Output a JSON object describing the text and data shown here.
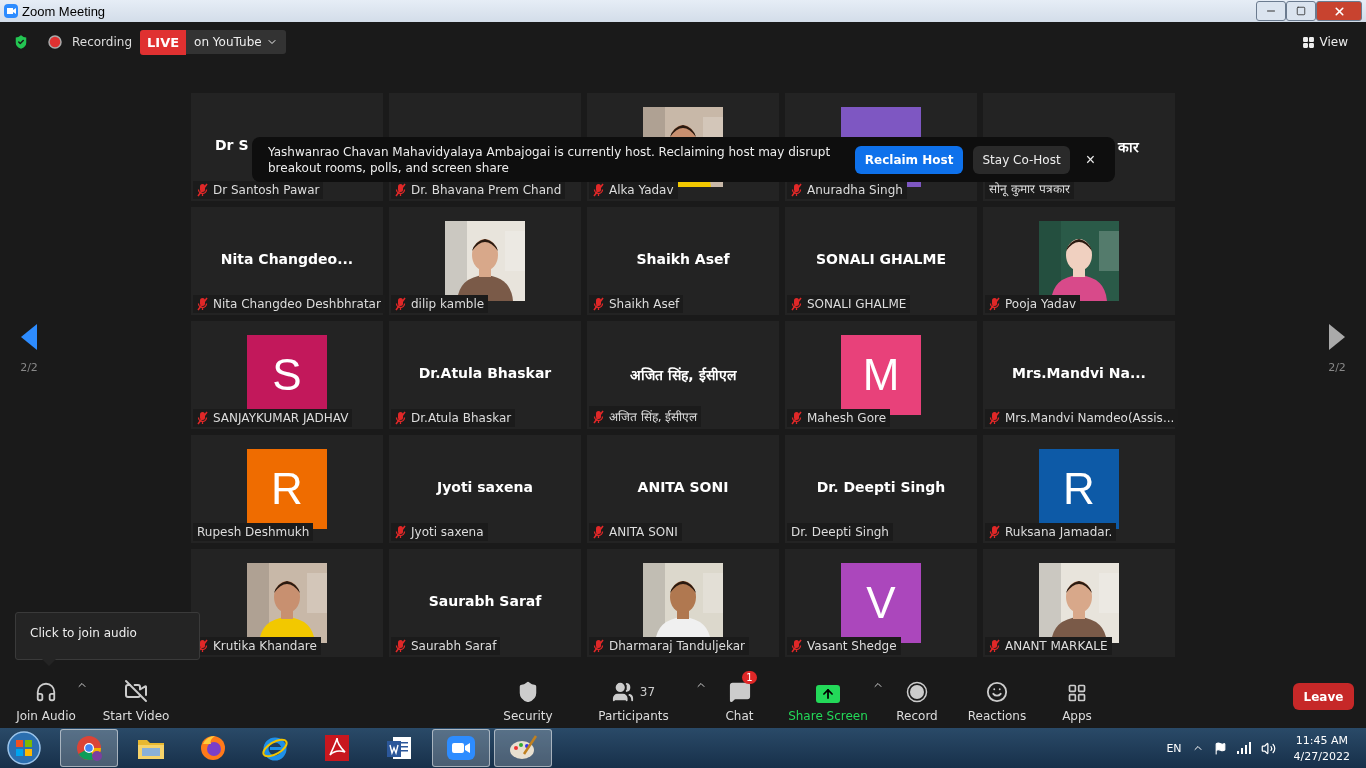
{
  "window": {
    "title": "Zoom Meeting"
  },
  "top_bar": {
    "recording": "Recording",
    "live": "LIVE",
    "stream": "on YouTube",
    "view": "View"
  },
  "banner": {
    "message": "Yashwanrao Chavan Mahavidyalaya Ambajogai is currently host. Reclaiming host may disrupt breakout rooms, polls, and screen share",
    "primary": "Reclaim Host",
    "secondary": "Stay Co-Host",
    "close": "×"
  },
  "pager": {
    "left": "2/2",
    "right": "2/2"
  },
  "tiles": [
    {
      "kind": "name",
      "display": "Dr S",
      "partial": true,
      "tail_hidden": true,
      "label": "Dr Santosh Pawar",
      "muted": true
    },
    {
      "kind": "name",
      "label": "Dr. Bhavana Prem Chand",
      "muted": true
    },
    {
      "kind": "picture",
      "label": "Alka Yadav",
      "muted": true
    },
    {
      "kind": "avatar",
      "color": "#7e57c2",
      "label": "Anuradha Singh",
      "muted": true
    },
    {
      "kind": "name",
      "display": "कार",
      "partial": true,
      "tail_hidden": false,
      "label": "सोनू  कुमार पत्रकार",
      "muted": false
    },
    {
      "kind": "name",
      "display": "Nita  Changdeo...",
      "label": "Nita Changdeo Deshbhratar",
      "muted": true
    },
    {
      "kind": "picture",
      "label": "dilip kamble",
      "muted": true
    },
    {
      "kind": "name",
      "display": "Shaikh Asef",
      "label": "Shaikh Asef",
      "muted": true
    },
    {
      "kind": "name",
      "display": "SONALI GHALME",
      "label": "SONALI GHALME",
      "muted": true
    },
    {
      "kind": "picture",
      "label": "Pooja Yadav",
      "muted": true
    },
    {
      "kind": "avatar",
      "letter": "S",
      "color": "#c2185b",
      "label": "SANJAYKUMAR JADHAV",
      "muted": true
    },
    {
      "kind": "name",
      "display": "Dr.Atula Bhaskar",
      "label": "Dr.Atula Bhaskar",
      "muted": true
    },
    {
      "kind": "name",
      "display": "अजित सिंह, ईसीएल",
      "label": "अजित  सिंह, ईसीएल",
      "muted": true
    },
    {
      "kind": "avatar",
      "letter": "M",
      "color": "#e8417a",
      "label": "Mahesh Gore",
      "muted": true
    },
    {
      "kind": "name",
      "display": "Mrs.Mandvi  Na...",
      "label": "Mrs.Mandvi Namdeo(Assis...",
      "muted": true
    },
    {
      "kind": "avatar",
      "letter": "R",
      "color": "#ef6c00",
      "label": "Rupesh Deshmukh",
      "muted": false
    },
    {
      "kind": "name",
      "display": "Jyoti saxena",
      "label": "Jyoti saxena",
      "muted": true
    },
    {
      "kind": "name",
      "display": "ANITA SONI",
      "label": "ANITA SONI",
      "muted": true
    },
    {
      "kind": "name",
      "display": "Dr. Deepti Singh",
      "label": "Dr. Deepti Singh",
      "muted": false
    },
    {
      "kind": "avatar",
      "letter": "R",
      "color": "#0d5aa7",
      "label": "Ruksana Jamadar.",
      "muted": true
    },
    {
      "kind": "picture",
      "label": "Krutika Khandare",
      "muted": true
    },
    {
      "kind": "name",
      "display": "Saurabh Saraf",
      "label": "Saurabh Saraf",
      "muted": true
    },
    {
      "kind": "picture",
      "label": "Dharmaraj Tanduljekar",
      "muted": true
    },
    {
      "kind": "avatar",
      "letter": "V",
      "color": "#ab47bc",
      "label": "Vasant Shedge",
      "muted": true
    },
    {
      "kind": "picture",
      "label": "ANANT MARKALE",
      "muted": true
    }
  ],
  "tooltip": "Click to join audio",
  "toolbar": [
    {
      "kind": "audio",
      "label": "Join Audio",
      "caret": true
    },
    {
      "kind": "video",
      "label": "Start Video"
    },
    {
      "kind": "security",
      "label": "Security"
    },
    {
      "kind": "participants",
      "label": "Participants",
      "count": "37",
      "caret": true
    },
    {
      "kind": "chat",
      "label": "Chat",
      "badge": "1"
    },
    {
      "kind": "share",
      "label": "Share Screen",
      "caret": true
    },
    {
      "kind": "record",
      "label": "Record"
    },
    {
      "kind": "reactions",
      "label": "Reactions"
    },
    {
      "kind": "apps",
      "label": "Apps"
    }
  ],
  "leave": "Leave",
  "taskbar": {
    "apps": [
      {
        "kind": "chrome",
        "running": true
      },
      {
        "kind": "explorer",
        "running": false
      },
      {
        "kind": "firefox",
        "running": false
      },
      {
        "kind": "ie",
        "running": false
      },
      {
        "kind": "acrobat",
        "running": false
      },
      {
        "kind": "word",
        "running": false
      },
      {
        "kind": "zoom",
        "running": true
      },
      {
        "kind": "paint",
        "running": true
      }
    ],
    "language": "EN",
    "time": "11:45 AM",
    "date": "4/27/2022"
  }
}
